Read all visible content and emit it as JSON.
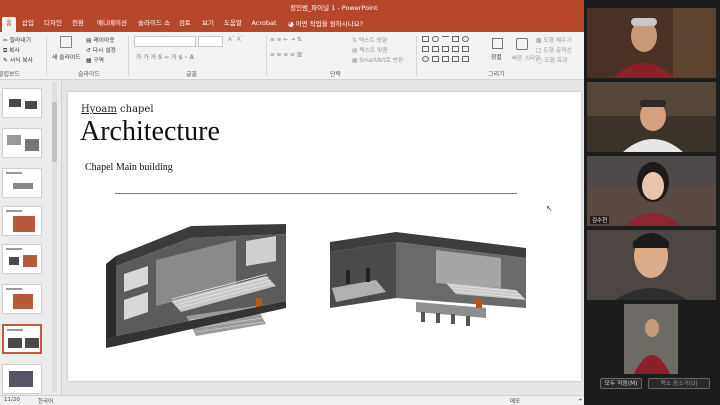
{
  "window": {
    "title": "정인범_파이널 1  -  PowerPoint"
  },
  "tabs": [
    "홈",
    "삽입",
    "디자인",
    "전환",
    "애니메이션",
    "슬라이드 쇼",
    "검토",
    "보기",
    "도움말",
    "Acrobat"
  ],
  "tell_me": "어떤 작업을 원하시나요?",
  "ribbon": {
    "clipboard": {
      "cut": "잘라내기",
      "copy": "복사",
      "format_copy": "서식 복사",
      "label": "클립보드"
    },
    "slides": {
      "new_slide": "새 슬라이드",
      "layout": "레이아웃",
      "reset": "다시 설정",
      "section": "구역",
      "label": "슬라이드"
    },
    "font": {
      "label": "글꼴"
    },
    "paragraph": {
      "text_direction": "텍스트 방향",
      "align_text": "텍스트 맞춤",
      "smartart": "SmartArt로 변환",
      "label": "단락"
    },
    "drawing": {
      "arrange": "정렬",
      "quick_styles": "빠른 스타일",
      "shape_fill": "도형 채우기",
      "shape_outline": "도형 윤곽선",
      "shape_effects": "도형 효과",
      "label": "그리기"
    }
  },
  "slide": {
    "subtitle_underlined": "Hyoam",
    "subtitle_rest": " chapel",
    "title": "Architecture",
    "caption": "Chapel Main building"
  },
  "participants": [
    {
      "name": ""
    },
    {
      "name": ""
    },
    {
      "name": "김수현"
    },
    {
      "name": ""
    },
    {
      "name": ""
    }
  ],
  "gallery_buttons": {
    "mute_all": "모두 작음(M)",
    "unmute_all": "목소 음소거(U)"
  },
  "status": {
    "slide_info": "11/20",
    "language": "한국어",
    "notes": "메모",
    "zoom": "+"
  },
  "colors": {
    "accent": "#b7472a"
  }
}
